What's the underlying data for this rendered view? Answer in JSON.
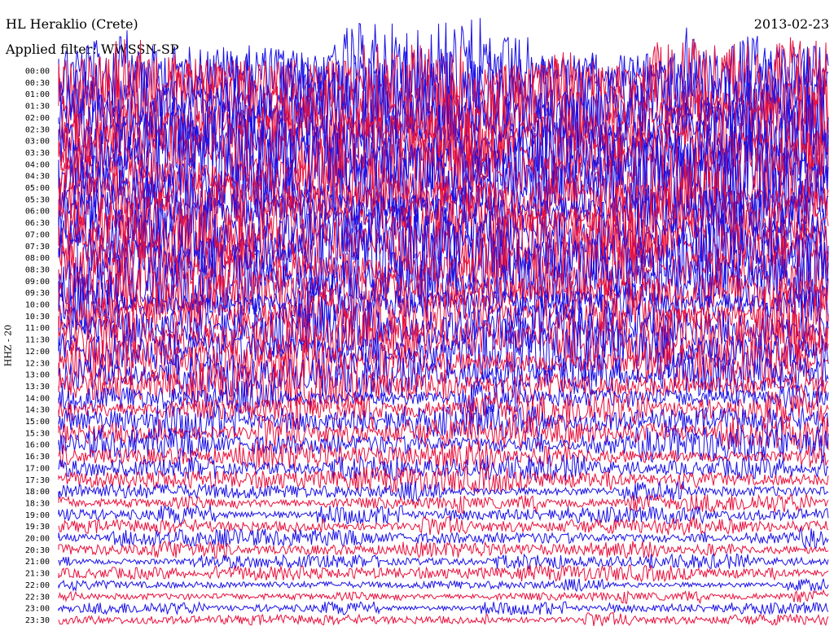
{
  "header": {
    "station": "HL Heraklio (Crete)",
    "date": "2013-02-23",
    "filter": "Applied filter: WWSSN-SP",
    "channel": "HHZ - 20"
  },
  "chart_data": {
    "type": "line",
    "title": "HL Heraklio (Crete)",
    "subtitle": "Applied filter: WWSSN-SP",
    "ylabel": "HHZ - 20",
    "xlabel": "",
    "row_labels": [
      "00:00",
      "00:30",
      "01:00",
      "01:30",
      "02:00",
      "02:30",
      "03:00",
      "03:30",
      "04:00",
      "04:30",
      "05:00",
      "05:30",
      "06:00",
      "06:30",
      "07:00",
      "07:30",
      "08:00",
      "08:30",
      "09:00",
      "09:30",
      "10:00",
      "10:30",
      "11:00",
      "11:30",
      "12:00",
      "12:30",
      "13:00",
      "13:30",
      "14:00",
      "14:30",
      "15:00",
      "15:30",
      "16:00",
      "16:30",
      "17:00",
      "17:30",
      "18:00",
      "18:30",
      "19:00",
      "19:30",
      "20:00",
      "20:30",
      "21:00",
      "21:30",
      "22:00",
      "22:30",
      "23:00",
      "23:30"
    ],
    "trace_colors": [
      "#1a10e6",
      "#e8103c"
    ],
    "relative_amplitude": [
      1.0,
      1.0,
      0.98,
      0.97,
      0.96,
      0.95,
      0.95,
      0.94,
      0.93,
      0.92,
      0.92,
      0.91,
      0.9,
      0.88,
      0.86,
      0.84,
      0.82,
      0.8,
      0.78,
      0.75,
      0.72,
      0.69,
      0.66,
      0.62,
      0.58,
      0.54,
      0.5,
      0.47,
      0.44,
      0.41,
      0.38,
      0.35,
      0.32,
      0.3,
      0.28,
      0.26,
      0.24,
      0.22,
      0.2,
      0.19,
      0.18,
      0.17,
      0.16,
      0.16,
      0.15,
      0.15,
      0.14,
      0.14
    ],
    "grid": false
  }
}
